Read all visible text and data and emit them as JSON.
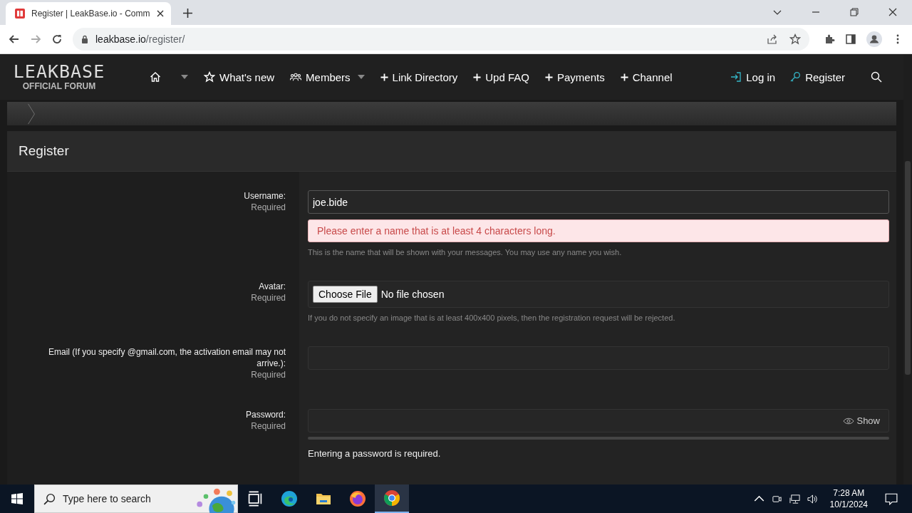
{
  "browser": {
    "tab_title": "Register | LeakBase.io - Comm",
    "url_host": "leakbase.io",
    "url_path": "/register/"
  },
  "site": {
    "logo_title": "LEAKBASE",
    "logo_subtitle": "OFFICIAL FORUM",
    "nav": [
      {
        "kind": "home",
        "dropdown": true
      },
      {
        "kind": "featured",
        "label": "What's new",
        "dropdown": false
      },
      {
        "kind": "members",
        "label": "Members",
        "dropdown": true
      },
      {
        "kind": "add",
        "label": "Link Directory",
        "dropdown": false
      },
      {
        "kind": "add",
        "label": "Upd FAQ",
        "dropdown": false
      },
      {
        "kind": "add",
        "label": "Payments",
        "dropdown": false
      },
      {
        "kind": "add",
        "label": "Channel",
        "dropdown": false
      }
    ],
    "account": [
      {
        "kind": "login",
        "label": "Log in"
      },
      {
        "kind": "register",
        "label": "Register"
      }
    ]
  },
  "page_title": "Register",
  "form": [
    {
      "kind": "text",
      "label": "Username:",
      "required": "Required",
      "value": "joe.bide",
      "error_box": "Please enter a name that is at least 4 characters long.",
      "hint": "This is the name that will be shown with your messages. You may use any name you wish."
    },
    {
      "kind": "file",
      "label": "Avatar:",
      "required": "Required",
      "button": "Choose File",
      "file_status": "No file chosen",
      "hint": "If you do not specify an image that is at least 400x400 pixels, then the registration request will be rejected."
    },
    {
      "kind": "text",
      "label": "Email (If you specify @gmail.com, the activation email may not arrive.):",
      "required": "Required"
    },
    {
      "kind": "password",
      "label": "Password:",
      "required": "Required",
      "toggle": "Show",
      "error_text": "Entering a password is required."
    }
  ],
  "taskbar": {
    "search_placeholder": "Type here to search",
    "time": "7:28 AM",
    "date": "10/1/2024"
  }
}
